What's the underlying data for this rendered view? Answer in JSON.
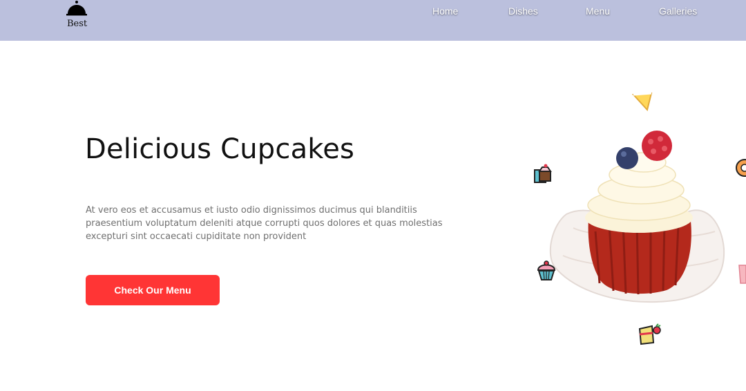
{
  "brand": {
    "name": "Best",
    "logo_icon": "cloche-icon"
  },
  "nav": {
    "items": [
      {
        "label": "Home"
      },
      {
        "label": "Dishes"
      },
      {
        "label": "Menu"
      },
      {
        "label": "Galleries"
      }
    ]
  },
  "hero": {
    "title": "Delicious Cupcakes",
    "description": "At vero eos et accusamus et iusto odio dignissimos ducimus qui blanditiis praesentium voluptatum deleniti atque corrupti quos dolores et quas molestias excepturi sint occaecati cupiditate non provident",
    "cta_label": "Check Our Menu"
  },
  "colors": {
    "navbar": "#bbc0dd",
    "cta": "#ff3535",
    "title": "#111111",
    "body_text": "#6f6f6f"
  }
}
